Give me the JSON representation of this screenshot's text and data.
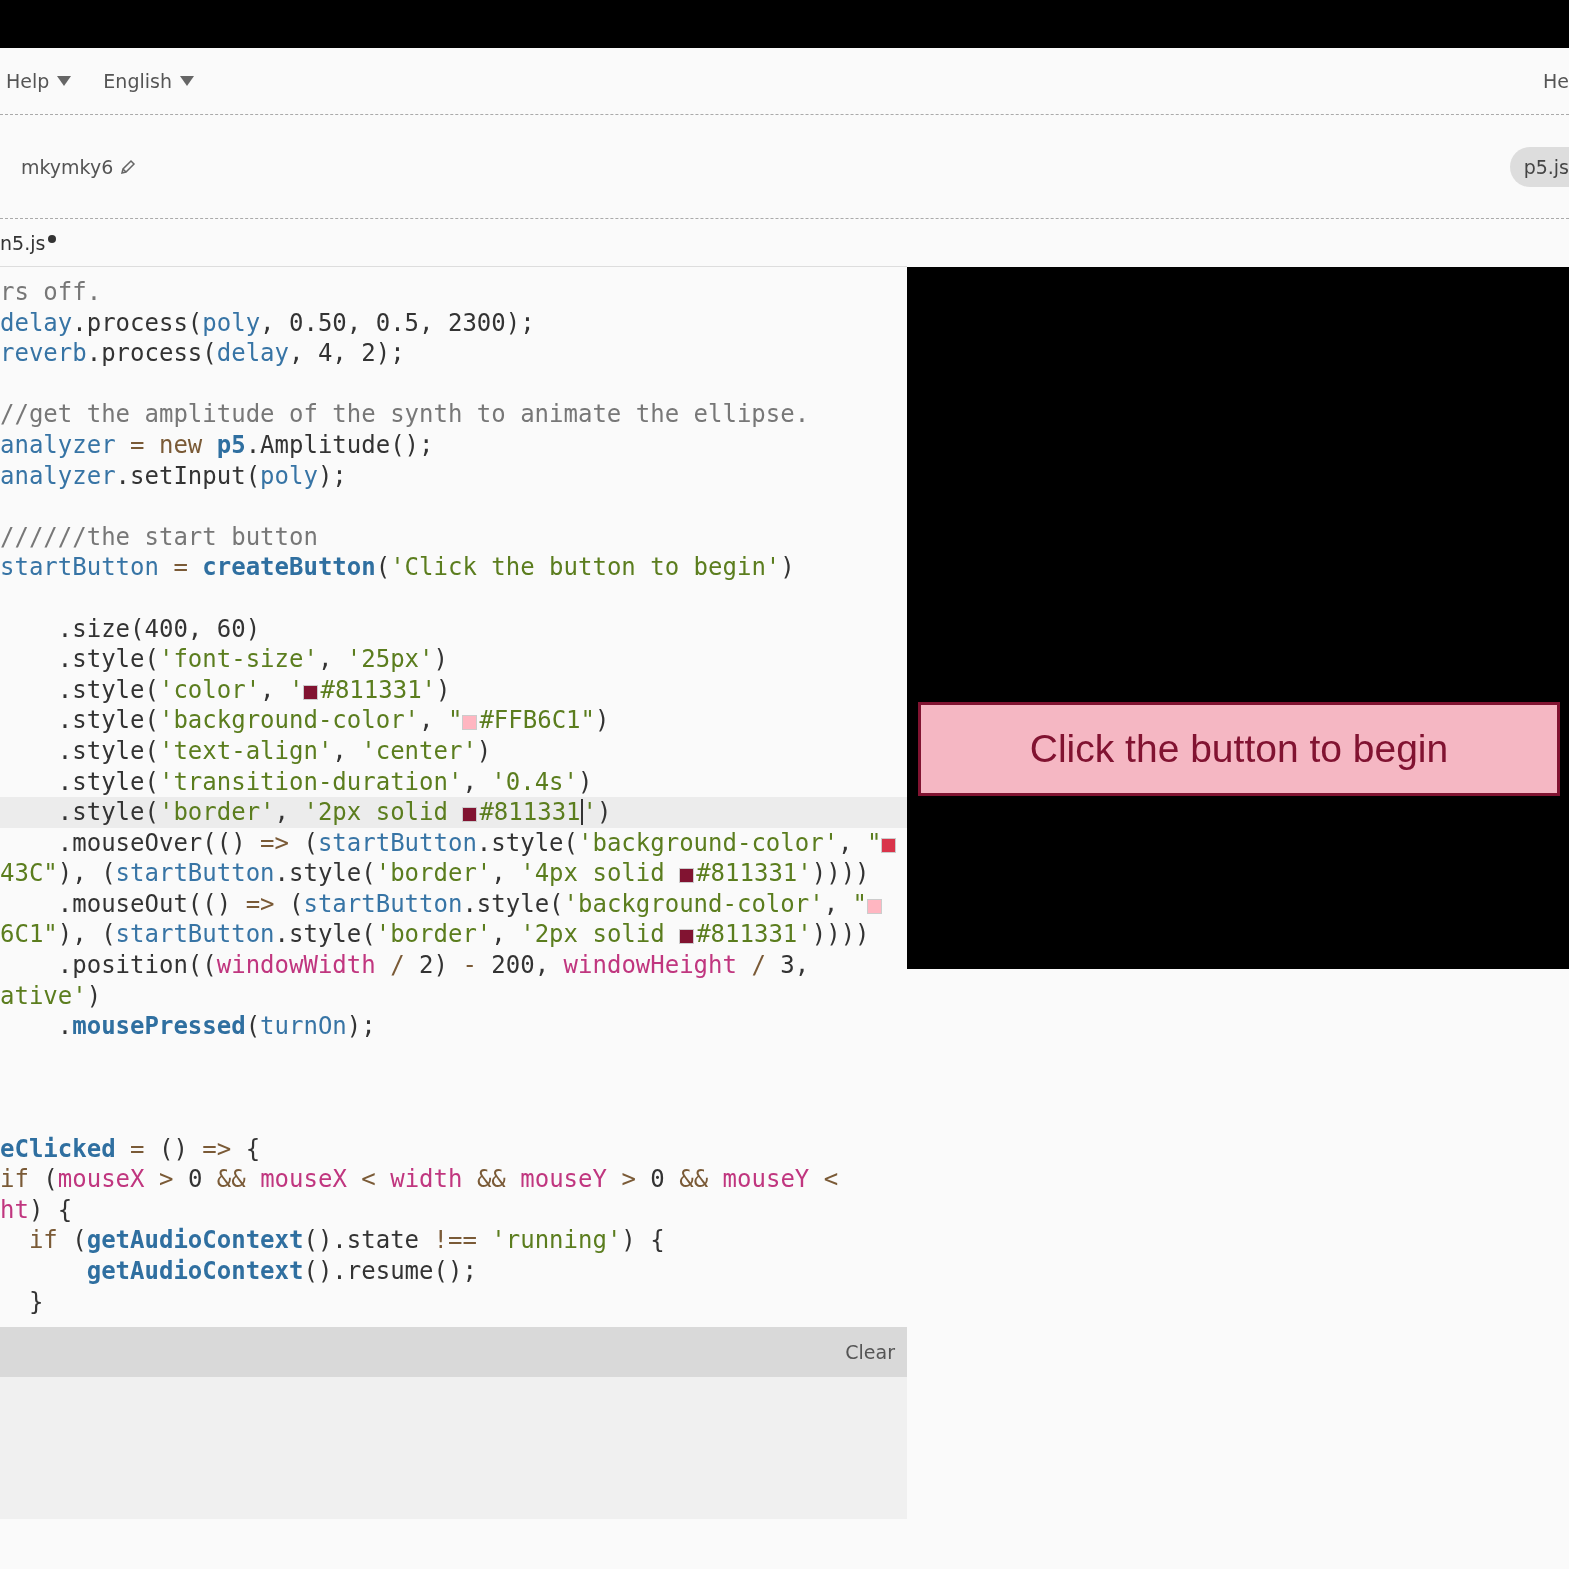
{
  "menu": [
    {
      "label": "Help"
    },
    {
      "label": "English"
    }
  ],
  "menu_right": "He",
  "project": {
    "name": "mkymky6",
    "version": "p5.js"
  },
  "file_tab": {
    "name": "n5.js",
    "unsaved": true
  },
  "code": [
    {
      "active": false,
      "tokens": [
        {
          "kind": "c",
          "text": "rs off."
        }
      ]
    },
    {
      "active": false,
      "tokens": [
        {
          "kind": "v",
          "text": "delay"
        },
        {
          "kind": "p",
          "text": ".process("
        },
        {
          "kind": "v",
          "text": "poly"
        },
        {
          "kind": "p",
          "text": ", 0.50, 0.5, 2300);"
        }
      ]
    },
    {
      "active": false,
      "tokens": [
        {
          "kind": "v",
          "text": "reverb"
        },
        {
          "kind": "p",
          "text": ".process("
        },
        {
          "kind": "v",
          "text": "delay"
        },
        {
          "kind": "p",
          "text": ", 4, 2);"
        }
      ]
    },
    {
      "active": false
    },
    {
      "active": false,
      "tokens": [
        {
          "kind": "c",
          "text": "//get the amplitude of the synth to animate the ellipse."
        }
      ]
    },
    {
      "active": false,
      "tokens": [
        {
          "kind": "v",
          "text": "analyzer"
        },
        {
          "kind": "k",
          "text": " = new "
        },
        {
          "kind": "f",
          "text": "p5"
        },
        {
          "kind": "p",
          "text": ".Amplitude();"
        }
      ]
    },
    {
      "active": false,
      "tokens": [
        {
          "kind": "v",
          "text": "analyzer"
        },
        {
          "kind": "p",
          "text": ".setInput("
        },
        {
          "kind": "v",
          "text": "poly"
        },
        {
          "kind": "p",
          "text": ");"
        }
      ]
    },
    {
      "active": false
    },
    {
      "active": false,
      "tokens": [
        {
          "kind": "c",
          "text": "//////the start button"
        }
      ]
    },
    {
      "active": false,
      "tokens": [
        {
          "kind": "v",
          "text": "startButton"
        },
        {
          "kind": "k",
          "text": " = "
        },
        {
          "kind": "f",
          "text": "createButton"
        },
        {
          "kind": "p",
          "text": "("
        },
        {
          "kind": "s",
          "text": "'Click the button to begin'"
        },
        {
          "kind": "p",
          "text": ")"
        }
      ]
    },
    {
      "active": false
    },
    {
      "active": false,
      "tokens": [
        {
          "kind": "p",
          "text": "    .size(400, 60)"
        }
      ]
    },
    {
      "active": false,
      "tokens": [
        {
          "kind": "p",
          "text": "    .style("
        },
        {
          "kind": "s",
          "text": "'font-size'"
        },
        {
          "kind": "p",
          "text": ", "
        },
        {
          "kind": "s",
          "text": "'25px'"
        },
        {
          "kind": "p",
          "text": ")"
        }
      ]
    },
    {
      "active": false,
      "tokens": [
        {
          "kind": "p",
          "text": "    .style("
        },
        {
          "kind": "s",
          "text": "'color'"
        },
        {
          "kind": "p",
          "text": ", "
        },
        {
          "kind": "s",
          "text": "'"
        },
        {
          "kind": "swatch",
          "color": "#811331"
        },
        {
          "kind": "s",
          "text": "#811331'"
        },
        {
          "kind": "p",
          "text": ")"
        }
      ]
    },
    {
      "active": false,
      "tokens": [
        {
          "kind": "p",
          "text": "    .style("
        },
        {
          "kind": "s",
          "text": "'background-color'"
        },
        {
          "kind": "p",
          "text": ", "
        },
        {
          "kind": "s",
          "text": "\""
        },
        {
          "kind": "swatch",
          "color": "#ffb6c1"
        },
        {
          "kind": "s",
          "text": "#FFB6C1\""
        },
        {
          "kind": "p",
          "text": ")"
        }
      ]
    },
    {
      "active": false,
      "tokens": [
        {
          "kind": "p",
          "text": "    .style("
        },
        {
          "kind": "s",
          "text": "'text-align'"
        },
        {
          "kind": "p",
          "text": ", "
        },
        {
          "kind": "s",
          "text": "'center'"
        },
        {
          "kind": "p",
          "text": ")"
        }
      ]
    },
    {
      "active": false,
      "tokens": [
        {
          "kind": "p",
          "text": "    .style("
        },
        {
          "kind": "s",
          "text": "'transition-duration'"
        },
        {
          "kind": "p",
          "text": ", "
        },
        {
          "kind": "s",
          "text": "'0.4s'"
        },
        {
          "kind": "p",
          "text": ")"
        }
      ]
    },
    {
      "active": true,
      "tokens": [
        {
          "kind": "p",
          "text": "    .style("
        },
        {
          "kind": "s",
          "text": "'border'"
        },
        {
          "kind": "p",
          "text": ", "
        },
        {
          "kind": "s",
          "text": "'2px solid "
        },
        {
          "kind": "swatch",
          "color": "#811331"
        },
        {
          "kind": "s",
          "text": "#811331"
        },
        {
          "kind": "cursor"
        },
        {
          "kind": "s",
          "text": "'"
        },
        {
          "kind": "p",
          "text": ")"
        }
      ]
    },
    {
      "active": false,
      "tokens": [
        {
          "kind": "p",
          "text": "    .mouseOver(() "
        },
        {
          "kind": "k",
          "text": "=>"
        },
        {
          "kind": "p",
          "text": " ("
        },
        {
          "kind": "v",
          "text": "startButton"
        },
        {
          "kind": "p",
          "text": ".style("
        },
        {
          "kind": "s",
          "text": "'background-color'"
        },
        {
          "kind": "p",
          "text": ", "
        },
        {
          "kind": "s",
          "text": "\""
        },
        {
          "kind": "swatch",
          "color": "#d9344a"
        }
      ]
    },
    {
      "active": false,
      "tokens": [
        {
          "kind": "s",
          "text": "43C\""
        },
        {
          "kind": "p",
          "text": "), ("
        },
        {
          "kind": "v",
          "text": "startButton"
        },
        {
          "kind": "p",
          "text": ".style("
        },
        {
          "kind": "s",
          "text": "'border'"
        },
        {
          "kind": "p",
          "text": ", "
        },
        {
          "kind": "s",
          "text": "'4px solid "
        },
        {
          "kind": "swatch",
          "color": "#811331"
        },
        {
          "kind": "s",
          "text": "#811331'"
        },
        {
          "kind": "p",
          "text": "))))"
        }
      ]
    },
    {
      "active": false,
      "tokens": [
        {
          "kind": "p",
          "text": "    .mouseOut(() "
        },
        {
          "kind": "k",
          "text": "=>"
        },
        {
          "kind": "p",
          "text": " ("
        },
        {
          "kind": "v",
          "text": "startButton"
        },
        {
          "kind": "p",
          "text": ".style("
        },
        {
          "kind": "s",
          "text": "'background-color'"
        },
        {
          "kind": "p",
          "text": ", "
        },
        {
          "kind": "s",
          "text": "\""
        },
        {
          "kind": "swatch",
          "color": "#ffb6c1"
        }
      ]
    },
    {
      "active": false,
      "tokens": [
        {
          "kind": "s",
          "text": "6C1\""
        },
        {
          "kind": "p",
          "text": "), ("
        },
        {
          "kind": "v",
          "text": "startButton"
        },
        {
          "kind": "p",
          "text": ".style("
        },
        {
          "kind": "s",
          "text": "'border'"
        },
        {
          "kind": "p",
          "text": ", "
        },
        {
          "kind": "s",
          "text": "'2px solid "
        },
        {
          "kind": "swatch",
          "color": "#811331"
        },
        {
          "kind": "s",
          "text": "#811331'"
        },
        {
          "kind": "p",
          "text": "))))"
        }
      ]
    },
    {
      "active": false,
      "tokens": [
        {
          "kind": "p",
          "text": "    .position(("
        },
        {
          "kind": "m",
          "text": "windowWidth"
        },
        {
          "kind": "k",
          "text": " / "
        },
        {
          "kind": "p",
          "text": "2) "
        },
        {
          "kind": "k",
          "text": "-"
        },
        {
          "kind": "p",
          "text": " 200, "
        },
        {
          "kind": "m",
          "text": "windowHeight"
        },
        {
          "kind": "k",
          "text": " / "
        },
        {
          "kind": "p",
          "text": "3,"
        }
      ]
    },
    {
      "active": false,
      "tokens": [
        {
          "kind": "s",
          "text": "ative'"
        },
        {
          "kind": "p",
          "text": ")"
        }
      ]
    },
    {
      "active": false,
      "tokens": [
        {
          "kind": "p",
          "text": "    ."
        },
        {
          "kind": "f",
          "text": "mousePressed"
        },
        {
          "kind": "p",
          "text": "("
        },
        {
          "kind": "v",
          "text": "turnOn"
        },
        {
          "kind": "p",
          "text": ");"
        }
      ]
    },
    {
      "active": false
    },
    {
      "active": false
    },
    {
      "active": false
    },
    {
      "active": false,
      "tokens": [
        {
          "kind": "f",
          "text": "eClicked"
        },
        {
          "kind": "k",
          "text": " = "
        },
        {
          "kind": "p",
          "text": "() "
        },
        {
          "kind": "k",
          "text": "=>"
        },
        {
          "kind": "p",
          "text": " {"
        }
      ]
    },
    {
      "active": false,
      "tokens": [
        {
          "kind": "k",
          "text": "if"
        },
        {
          "kind": "p",
          "text": " ("
        },
        {
          "kind": "m",
          "text": "mouseX"
        },
        {
          "kind": "k",
          "text": " > "
        },
        {
          "kind": "p",
          "text": "0 "
        },
        {
          "kind": "k",
          "text": "&& "
        },
        {
          "kind": "m",
          "text": "mouseX"
        },
        {
          "kind": "k",
          "text": " < "
        },
        {
          "kind": "m",
          "text": "width"
        },
        {
          "kind": "k",
          "text": " && "
        },
        {
          "kind": "m",
          "text": "mouseY"
        },
        {
          "kind": "k",
          "text": " > "
        },
        {
          "kind": "p",
          "text": "0 "
        },
        {
          "kind": "k",
          "text": "&& "
        },
        {
          "kind": "m",
          "text": "mouseY"
        },
        {
          "kind": "k",
          "text": " <"
        }
      ]
    },
    {
      "active": false,
      "tokens": [
        {
          "kind": "m",
          "text": "ht"
        },
        {
          "kind": "p",
          "text": ") {"
        }
      ]
    },
    {
      "active": false,
      "tokens": [
        {
          "kind": "k",
          "text": "  if"
        },
        {
          "kind": "p",
          "text": " ("
        },
        {
          "kind": "f",
          "text": "getAudioContext"
        },
        {
          "kind": "p",
          "text": "().state "
        },
        {
          "kind": "k",
          "text": "!== "
        },
        {
          "kind": "s",
          "text": "'running'"
        },
        {
          "kind": "p",
          "text": ") {"
        }
      ]
    },
    {
      "active": false,
      "tokens": [
        {
          "kind": "f",
          "text": "      getAudioContext"
        },
        {
          "kind": "p",
          "text": "().resume();"
        }
      ]
    },
    {
      "active": false,
      "tokens": [
        {
          "kind": "p",
          "text": "  }"
        }
      ]
    }
  ],
  "preview": {
    "button_label": "Click the button to begin"
  },
  "console": {
    "clear_label": "Clear"
  }
}
